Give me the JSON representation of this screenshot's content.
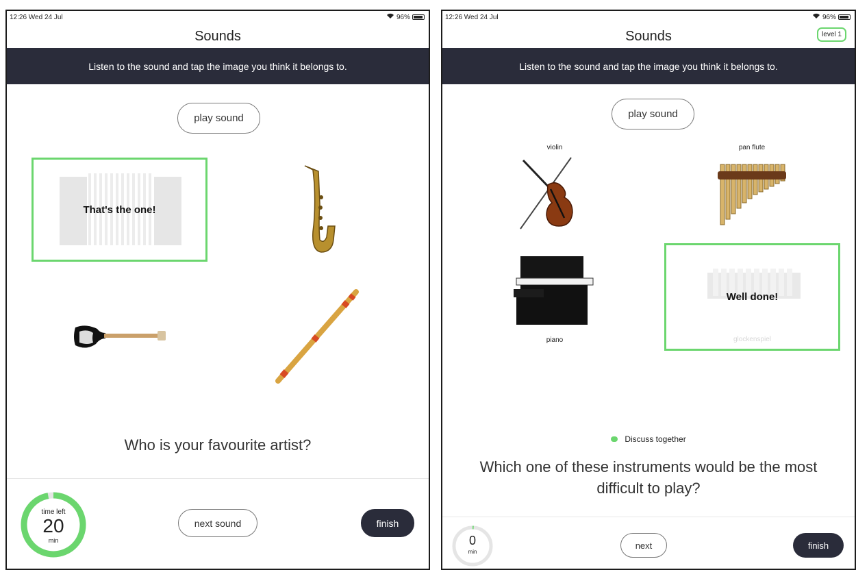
{
  "left": {
    "status": {
      "time": "12:26  Wed 24 Jul",
      "battery": "96%"
    },
    "title": "Sounds",
    "instruction": "Listen to the sound and tap the image you think it belongs to.",
    "play_sound": "play sound",
    "selected_message": "That's the one!",
    "question": "Who is your favourite artist?",
    "timer": {
      "label": "time left",
      "value": "20",
      "unit": "min",
      "progress": 0.97
    },
    "next_label": "next sound",
    "finish_label": "finish"
  },
  "right": {
    "status": {
      "time": "12:26  Wed 24 Jul",
      "battery": "96%"
    },
    "title": "Sounds",
    "level": "level 1",
    "instruction": "Listen to the sound and tap the image you think it belongs to.",
    "play_sound": "play sound",
    "labels": {
      "violin": "violin",
      "pan_flute": "pan flute",
      "piano": "piano",
      "glockenspiel": "glockenspiel"
    },
    "selected_message": "Well done!",
    "discuss": "Discuss together",
    "question": "Which one of these instruments would be the most difficult to play?",
    "timer": {
      "value": "0",
      "unit": "min",
      "progress": 0.01
    },
    "next_label": "next",
    "finish_label": "finish"
  },
  "colors": {
    "accent": "#6bd66e",
    "dark": "#2a2c3a"
  }
}
